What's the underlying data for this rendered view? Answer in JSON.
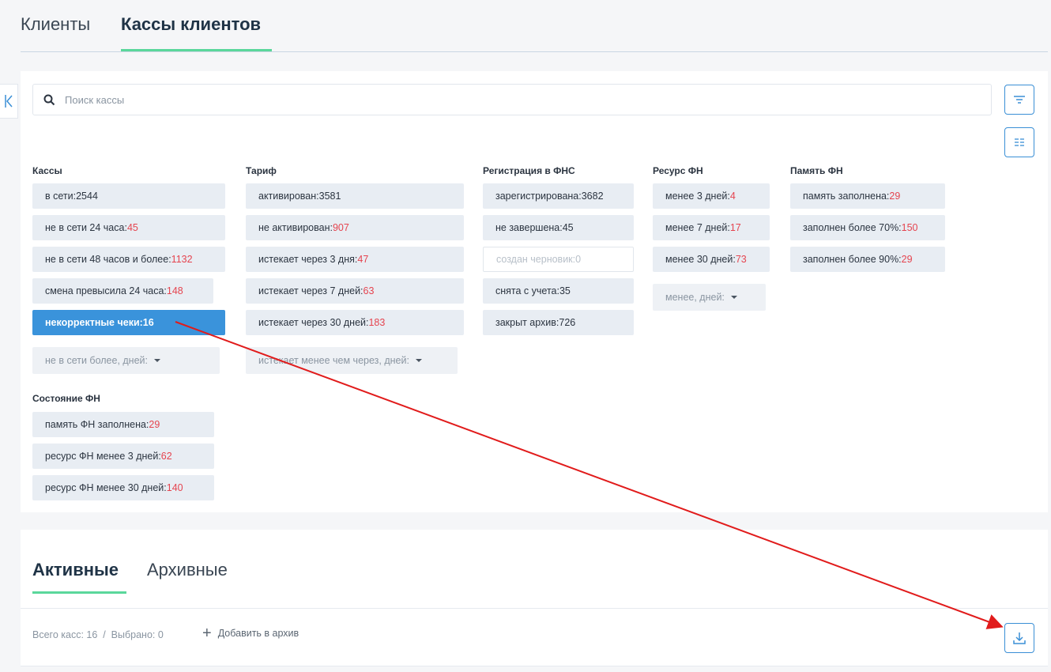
{
  "top_tabs": [
    {
      "label": "Клиенты"
    },
    {
      "label": "Кассы клиентов"
    }
  ],
  "search": {
    "placeholder": "Поиск кассы",
    "value": ""
  },
  "groups": {
    "kassy": {
      "title": "Кассы",
      "chips": [
        {
          "label": "в сети: ",
          "count": "2544",
          "red": false
        },
        {
          "label": "не в сети 24 часа: ",
          "count": "45",
          "red": true
        },
        {
          "label": "не в сети 48 часов и более: ",
          "count": "1132",
          "red": true
        },
        {
          "label": "смена превысила 24 часа: ",
          "count": "148",
          "red": true
        },
        {
          "label": "некорректные чеки: ",
          "count": "16",
          "active": true
        }
      ],
      "dropdown": "не в сети более, дней:"
    },
    "tarif": {
      "title": "Тариф",
      "chips": [
        {
          "label": "активирован: ",
          "count": "3581",
          "red": false
        },
        {
          "label": "не активирован: ",
          "count": "907",
          "red": true
        },
        {
          "label": "истекает через 3 дня: ",
          "count": "47",
          "red": true
        },
        {
          "label": "истекает через 7 дней: ",
          "count": "63",
          "red": true
        },
        {
          "label": "истекает через 30 дней: ",
          "count": "183",
          "red": true
        }
      ],
      "dropdown": "истекает менее чем через, дней:"
    },
    "fns": {
      "title": "Регистрация в ФНС",
      "chips": [
        {
          "label": "зарегистрирована: ",
          "count": "3682",
          "red": false
        },
        {
          "label": "не завершена: ",
          "count": "45",
          "red": false
        },
        {
          "label": "создан черновик: ",
          "count": "0",
          "disabled": true
        },
        {
          "label": "снята с учета: ",
          "count": "35",
          "red": false
        },
        {
          "label": "закрыт архив: ",
          "count": "726",
          "red": false
        }
      ]
    },
    "resurs": {
      "title": "Ресурс ФН",
      "chips": [
        {
          "label": "менее 3 дней: ",
          "count": "4",
          "red": true
        },
        {
          "label": "менее 7 дней: ",
          "count": "17",
          "red": true
        },
        {
          "label": "менее 30 дней: ",
          "count": "73",
          "red": true
        }
      ],
      "dropdown": "менее, дней:"
    },
    "pamyat": {
      "title": "Память ФН",
      "chips": [
        {
          "label": "память заполнена: ",
          "count": "29",
          "red": true
        },
        {
          "label": "заполнен более 70%: ",
          "count": "150",
          "red": true
        },
        {
          "label": "заполнен более 90%: ",
          "count": "29",
          "red": true
        }
      ]
    },
    "sostoyanie": {
      "title": "Состояние ФН",
      "chips": [
        {
          "label": "память ФН заполнена: ",
          "count": "29",
          "red": true
        },
        {
          "label": "ресурс ФН менее 3 дней: ",
          "count": "62",
          "red": true
        },
        {
          "label": "ресурс ФН менее 30 дней: ",
          "count": "140",
          "red": true
        }
      ]
    }
  },
  "sub_tabs": [
    {
      "label": "Активные"
    },
    {
      "label": "Архивные"
    }
  ],
  "footer": {
    "total": "Всего касс: 16  /  Выбрано: 0",
    "add_archive": "Добавить в архив"
  },
  "colors": {
    "accent": "#3a93db",
    "red": "#e5444f",
    "green": "#5ad79b",
    "annotation": "#e11b1b"
  }
}
